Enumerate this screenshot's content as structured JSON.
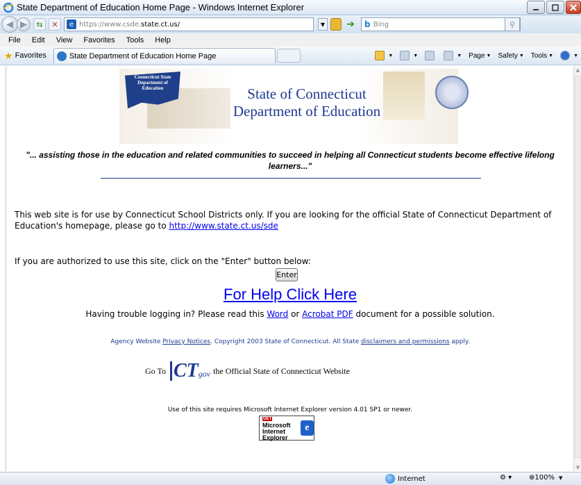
{
  "window": {
    "title": "State Department of Education Home Page - Windows Internet Explorer"
  },
  "address": {
    "url_prefix": "https://www.csde.",
    "url_rest": "state.ct.us/",
    "search_placeholder": "Bing"
  },
  "menu": [
    "File",
    "Edit",
    "View",
    "Favorites",
    "Tools",
    "Help"
  ],
  "favorites": {
    "label": "Favorites",
    "tab_title": "State Department of Education Home Page"
  },
  "commands": {
    "page": "Page",
    "safety": "Safety",
    "tools": "Tools"
  },
  "banner": {
    "map_text": "Connecticut State Department of Education",
    "title_line1": "State of Connecticut",
    "title_line2": "Department of Education"
  },
  "content": {
    "tagline": "\"... assisting those in the education and related communities to succeed in helping all Connecticut students become effective lifelong learners...\"",
    "notice_text": "This web site is for use by Connecticut School Districts only. If you are looking for the official State of Connecticut Department of Education's homepage, please go to ",
    "notice_link": "http://www.state.ct.us/sde",
    "auth_text": "If you are authorized to use this site, click on the \"Enter\" button below:",
    "enter_button": "Enter",
    "help_link": "For Help Click Here",
    "trouble_prefix": "Having trouble logging in? Please read this ",
    "word_link": "Word",
    "or_text": " or ",
    "pdf_link": "Acrobat PDF",
    "trouble_suffix": " document for a possible solution.",
    "footer_prefix": "Agency Website ",
    "privacy_link": "Privacy Notices",
    "footer_mid": ". Copyright 2003 State of Connecticut. All State ",
    "disclaimer_link": "disclaimers and permissions",
    "footer_suffix": " apply.",
    "goto_text": "Go To",
    "ctgov_ct": "CT",
    "ctgov_gov": "gov",
    "goto_suffix": "the Official State of Connecticut Website",
    "ie_note": "Use of this site requires Microsoft Internet Explorer version 4.01 SP1 or newer.",
    "ie_badge_get": "GET",
    "ie_badge_line1": "Microsoft",
    "ie_badge_line2": "Internet",
    "ie_badge_line3": "Explorer"
  },
  "status": {
    "zone": "Internet",
    "zoom": "100%"
  }
}
